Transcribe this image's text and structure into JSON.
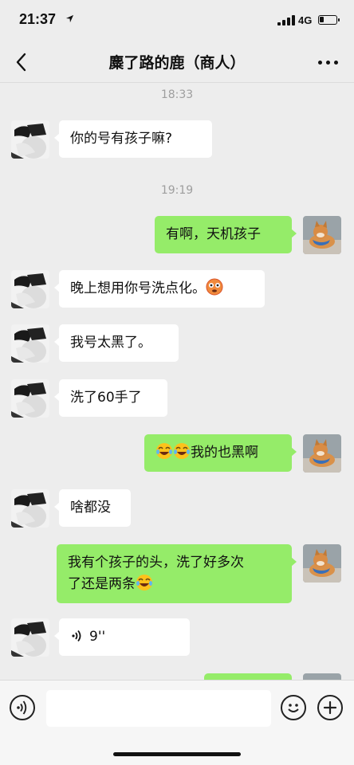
{
  "status_bar": {
    "time": "21:37",
    "location_icon": "location-arrow-icon",
    "network": "4G",
    "battery_level": 0.2
  },
  "nav": {
    "title": "麋了路的鹿（商人）",
    "back_icon": "chevron-left-icon",
    "more_icon": "ellipsis-icon"
  },
  "messages": [
    {
      "type": "timestamp",
      "text": "18:33"
    },
    {
      "type": "message",
      "side": "left",
      "text": "你的号有孩子嘛?"
    },
    {
      "type": "timestamp",
      "text": "19:19"
    },
    {
      "type": "message",
      "side": "right",
      "text": "有啊，天机孩子"
    },
    {
      "type": "message",
      "side": "left",
      "text": "晚上想用你号洗点化。",
      "emoji": "flushed-face-emoji"
    },
    {
      "type": "message",
      "side": "left",
      "text": "我号太黑了。"
    },
    {
      "type": "message",
      "side": "left",
      "text": "洗了60手了"
    },
    {
      "type": "message",
      "side": "right",
      "text": "我的也黑啊",
      "emoji_prefix": [
        "tears-of-joy-emoji",
        "tears-of-joy-emoji"
      ]
    },
    {
      "type": "message",
      "side": "left",
      "text": "啥都没"
    },
    {
      "type": "message",
      "side": "right",
      "line1": "我有个孩子的头，洗了好多次",
      "line2": "了还是两条",
      "emoji": "tears-of-joy-emoji"
    },
    {
      "type": "voice",
      "side": "left",
      "duration": "9''"
    },
    {
      "type": "message",
      "side": "right",
      "text": ""
    }
  ],
  "input_bar": {
    "voice_icon": "voice-icon",
    "emoji_icon": "smiley-icon",
    "plus_icon": "plus-icon",
    "placeholder": ""
  },
  "colors": {
    "background": "#ededed",
    "bubble_self": "#95ec69",
    "bubble_other": "#ffffff",
    "timestamp": "#9e9e9e"
  }
}
